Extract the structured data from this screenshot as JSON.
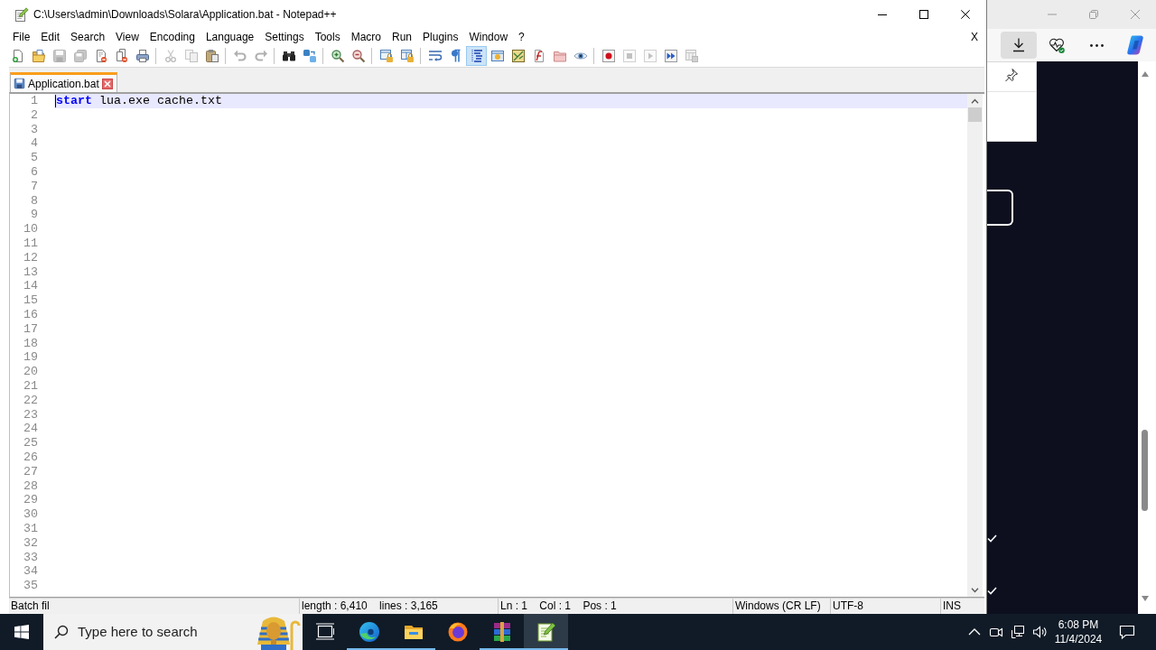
{
  "window": {
    "title": "C:\\Users\\admin\\Downloads\\Solara\\Application.bat - Notepad++"
  },
  "menu": {
    "items": [
      "File",
      "Edit",
      "Search",
      "View",
      "Encoding",
      "Language",
      "Settings",
      "Tools",
      "Macro",
      "Run",
      "Plugins",
      "Window",
      "?"
    ],
    "close_document": "X"
  },
  "toolbar": {
    "groups": [
      {
        "buttons": [
          {
            "kind": "new",
            "on": false,
            "disabled": false
          },
          {
            "kind": "open",
            "on": false,
            "disabled": false
          },
          {
            "kind": "save",
            "on": false,
            "disabled": true
          },
          {
            "kind": "save-all",
            "on": false,
            "disabled": true
          },
          {
            "kind": "close",
            "on": false,
            "disabled": false
          },
          {
            "kind": "close-all",
            "on": false,
            "disabled": false
          },
          {
            "kind": "print",
            "on": false,
            "disabled": false
          }
        ]
      },
      {
        "buttons": [
          {
            "kind": "cut",
            "on": false,
            "disabled": true
          },
          {
            "kind": "copy",
            "on": false,
            "disabled": true
          },
          {
            "kind": "paste",
            "on": false,
            "disabled": false
          }
        ]
      },
      {
        "buttons": [
          {
            "kind": "undo",
            "on": false,
            "disabled": true
          },
          {
            "kind": "redo",
            "on": false,
            "disabled": true
          }
        ]
      },
      {
        "buttons": [
          {
            "kind": "find",
            "on": false,
            "disabled": false
          },
          {
            "kind": "replace",
            "on": false,
            "disabled": false
          }
        ]
      },
      {
        "buttons": [
          {
            "kind": "zoom-in",
            "on": false,
            "disabled": false
          },
          {
            "kind": "zoom-out",
            "on": false,
            "disabled": false
          }
        ]
      },
      {
        "buttons": [
          {
            "kind": "sync-vertical",
            "on": false,
            "disabled": false
          },
          {
            "kind": "sync-horizontal",
            "on": false,
            "disabled": false
          }
        ]
      },
      {
        "buttons": [
          {
            "kind": "word-wrap",
            "on": false,
            "disabled": false
          },
          {
            "kind": "show-all",
            "on": false,
            "disabled": false
          },
          {
            "kind": "indent-guide",
            "on": true,
            "disabled": false
          },
          {
            "kind": "user-language",
            "on": false,
            "disabled": false
          },
          {
            "kind": "document-map",
            "on": false,
            "disabled": false
          },
          {
            "kind": "function-list",
            "on": false,
            "disabled": false
          },
          {
            "kind": "workspace",
            "on": false,
            "disabled": false
          },
          {
            "kind": "monitoring",
            "on": false,
            "disabled": false
          }
        ]
      },
      {
        "buttons": [
          {
            "kind": "record",
            "on": false,
            "disabled": false
          },
          {
            "kind": "stop",
            "on": false,
            "disabled": true
          },
          {
            "kind": "play",
            "on": false,
            "disabled": true
          },
          {
            "kind": "play-multiple",
            "on": false,
            "disabled": false
          },
          {
            "kind": "save-macro",
            "on": false,
            "disabled": true
          }
        ]
      }
    ]
  },
  "tabs": [
    {
      "label": "Application.bat",
      "selected": true
    }
  ],
  "editor": {
    "lines": [
      {
        "number": "1",
        "current": true,
        "tokens": [
          {
            "kind": "keyword",
            "text": "start"
          },
          {
            "kind": "plain",
            "text": " lua.exe cache.txt"
          }
        ]
      },
      {
        "number": "2",
        "current": false
      },
      {
        "number": "3",
        "current": false
      },
      {
        "number": "4",
        "current": false
      },
      {
        "number": "5",
        "current": false
      },
      {
        "number": "6",
        "current": false
      },
      {
        "number": "7",
        "current": false
      },
      {
        "number": "8",
        "current": false
      },
      {
        "number": "9",
        "current": false
      },
      {
        "number": "10",
        "current": false
      },
      {
        "number": "11",
        "current": false
      },
      {
        "number": "12",
        "current": false
      },
      {
        "number": "13",
        "current": false
      },
      {
        "number": "14",
        "current": false
      },
      {
        "number": "15",
        "current": false
      },
      {
        "number": "16",
        "current": false
      },
      {
        "number": "17",
        "current": false
      },
      {
        "number": "18",
        "current": false
      },
      {
        "number": "19",
        "current": false
      },
      {
        "number": "20",
        "current": false
      },
      {
        "number": "21",
        "current": false
      },
      {
        "number": "22",
        "current": false
      },
      {
        "number": "23",
        "current": false
      },
      {
        "number": "24",
        "current": false
      },
      {
        "number": "25",
        "current": false
      },
      {
        "number": "26",
        "current": false
      },
      {
        "number": "27",
        "current": false
      },
      {
        "number": "28",
        "current": false
      },
      {
        "number": "29",
        "current": false
      },
      {
        "number": "30",
        "current": false
      },
      {
        "number": "31",
        "current": false
      },
      {
        "number": "32",
        "current": false
      },
      {
        "number": "33",
        "current": false
      },
      {
        "number": "34",
        "current": false
      },
      {
        "number": "35",
        "current": false
      }
    ]
  },
  "status_bar": {
    "fields": [
      "Batch fil",
      "length : 6,410    lines : 3,165",
      "Ln : 1    Col : 1    Pos : 1",
      "Windows (CR LF)",
      "UTF-8",
      "INS"
    ]
  },
  "browser": {
    "toolbar": [
      {
        "kind": "downloads",
        "selected": true
      },
      {
        "kind": "health",
        "selected": false
      },
      {
        "kind": "more",
        "selected": false
      },
      {
        "kind": "logo",
        "selected": false
      }
    ]
  },
  "taskbar": {
    "search": {
      "placeholder": "Type here to search"
    },
    "apps": [
      {
        "kind": "task-view",
        "running": false,
        "active": false
      },
      {
        "kind": "swirl",
        "running": true,
        "active": false
      },
      {
        "kind": "folder",
        "running": true,
        "active": false
      },
      {
        "kind": "globe",
        "running": false,
        "active": false
      },
      {
        "kind": "books",
        "running": true,
        "active": false
      },
      {
        "kind": "notepad",
        "running": true,
        "active": true
      }
    ],
    "clock": {
      "time": "6:08 PM",
      "date": "11/4/2024"
    }
  }
}
